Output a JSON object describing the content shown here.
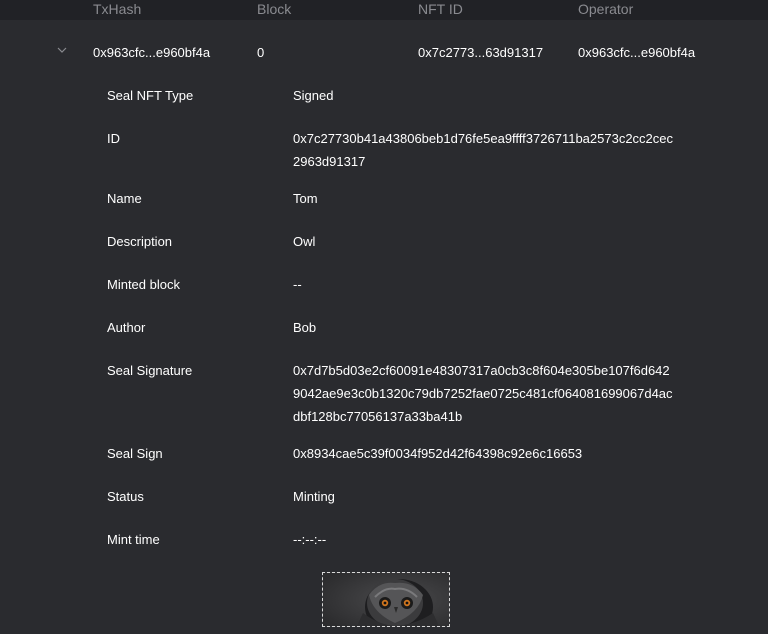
{
  "table": {
    "headers": {
      "txhash": "TxHash",
      "block": "Block",
      "nft_id": "NFT ID",
      "operator": "Operator"
    },
    "row": {
      "txhash": "0x963cfc...e960bf4a",
      "block": "0",
      "nft_id": "0x7c2773...63d91317",
      "operator": "0x963cfc...e960bf4a"
    }
  },
  "details": [
    {
      "label": "Seal NFT Type",
      "value": "Signed"
    },
    {
      "label": "ID",
      "value": "0x7c27730b41a43806beb1d76fe5ea9ffff3726711ba2573c2cc2cec2963d91317"
    },
    {
      "label": "Name",
      "value": "Tom"
    },
    {
      "label": "Description",
      "value": "Owl"
    },
    {
      "label": "Minted block",
      "value": "--"
    },
    {
      "label": "Author",
      "value": "Bob"
    },
    {
      "label": "Seal Signature",
      "value": "0x7d7b5d03e2cf60091e48307317a0cb3c8f604e305be107f6d6429042ae9e3c0b1320c79db7252fae0725c481cf064081699067d4acdbf128bc77056137a33ba41b"
    },
    {
      "label": "Seal Sign",
      "value": "0x8934cae5c39f0034f952d42f64398c92e6c16653"
    },
    {
      "label": "Status",
      "value": "Minting"
    },
    {
      "label": "Mint time",
      "value": "--:--:--"
    }
  ],
  "colors": {
    "background": "#212226",
    "row_background": "#2a2b2f",
    "header_text": "#8a8b90",
    "text": "#ffffff"
  }
}
